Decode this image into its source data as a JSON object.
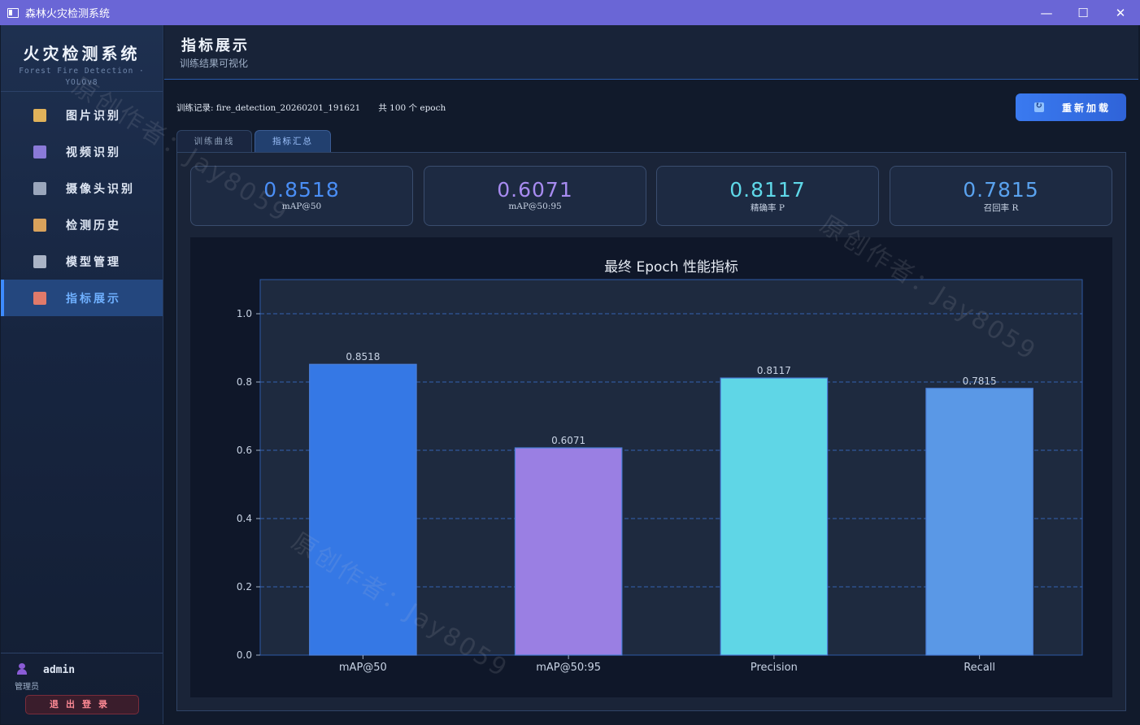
{
  "window": {
    "title": "森林火灾检测系统",
    "controls": {
      "minimize": "—",
      "maximize": "☐",
      "close": "✕"
    }
  },
  "sidebar": {
    "brand_title": "火灾检测系统",
    "brand_sub_1": "Forest Fire Detection ·",
    "brand_sub_2": "YOLOv8",
    "items": [
      {
        "label": "图片识别",
        "icon": "image-icon",
        "icon_color": "#e0b25a"
      },
      {
        "label": "视频识别",
        "icon": "clapperboard-icon",
        "icon_color": "#8a7ad8"
      },
      {
        "label": "摄像头识别",
        "icon": "camera-icon",
        "icon_color": "#9aa6bc"
      },
      {
        "label": "检测历史",
        "icon": "clipboard-icon",
        "icon_color": "#d9a25c"
      },
      {
        "label": "模型管理",
        "icon": "gear-icon",
        "icon_color": "#aab4c6"
      },
      {
        "label": "指标展示",
        "icon": "bar-chart-icon",
        "icon_color": "#e07a6a"
      }
    ],
    "active_index": 5,
    "user": {
      "name": "admin",
      "role": "管理员",
      "logout_label": "退出登录"
    }
  },
  "header": {
    "title": "指标展示",
    "subtitle": "训练结果可视化"
  },
  "record": {
    "label": "训练记录: fire_detection_20260201_191621",
    "epochs": "共 100 个 epoch"
  },
  "reload_label": "重新加载",
  "tabs": [
    {
      "label": "训练曲线",
      "active": false
    },
    {
      "label": "指标汇总",
      "active": true
    }
  ],
  "cards": [
    {
      "value": "0.8518",
      "label": "mAP@50",
      "color": "#4a8ef5"
    },
    {
      "value": "0.6071",
      "label": "mAP@50:95",
      "color": "#a78bf0"
    },
    {
      "value": "0.8117",
      "label": "精确率 P",
      "color": "#5fd8e8"
    },
    {
      "value": "0.7815",
      "label": "召回率 R",
      "color": "#5aa2ee"
    }
  ],
  "watermark": "原创作者：Jay8059",
  "chart_data": {
    "type": "bar",
    "title": "最终 Epoch 性能指标",
    "categories": [
      "mAP@50",
      "mAP@50:95",
      "Precision",
      "Recall"
    ],
    "values": [
      0.8518,
      0.6071,
      0.8117,
      0.7815
    ],
    "value_labels": [
      "0.8518",
      "0.6071",
      "0.8117",
      "0.7815"
    ],
    "colors": [
      "#3578e5",
      "#9a7fe3",
      "#5fd6e6",
      "#5a98e6"
    ],
    "ylim": [
      0,
      1.1
    ],
    "yticks": [
      0.0,
      0.2,
      0.4,
      0.6,
      0.8,
      1.0
    ],
    "ytick_labels": [
      "0.0",
      "0.2",
      "0.4",
      "0.6",
      "0.8",
      "1.0"
    ],
    "grid": true,
    "xlabel": "",
    "ylabel": ""
  }
}
